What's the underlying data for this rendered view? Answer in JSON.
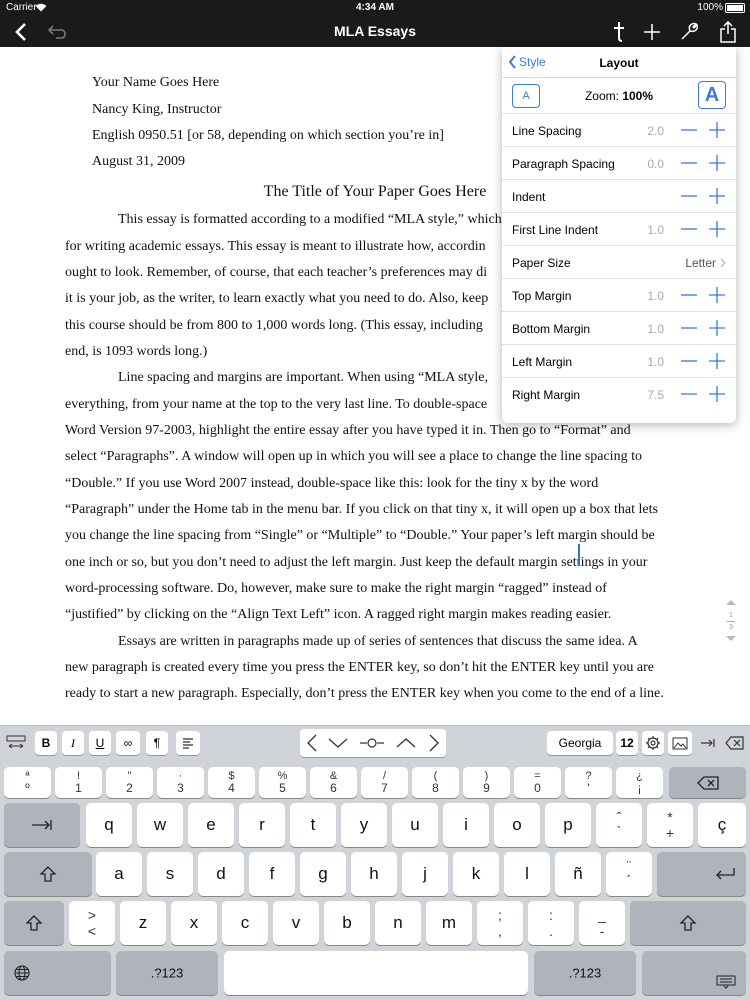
{
  "status_bar": {
    "carrier": "Carrier",
    "time": "4:34 AM",
    "battery": "100%"
  },
  "nav_bar": {
    "title": "MLA Essays",
    "icons": [
      "back-icon",
      "undo-icon",
      "text-style-icon",
      "add-icon",
      "wrench-icon",
      "share-icon"
    ]
  },
  "document": {
    "heading_lines": [
      "Your Name Goes Here",
      "Nancy King, Instructor",
      "English 0950.51 [or 58, depending on which section you’re in]",
      "August 31, 2009"
    ],
    "title": "The Title of Your Paper Goes Here",
    "body_lines": [
      "This essay is formatted according to a modified “MLA style,” which",
      "for writing academic essays.  This essay is meant to illustrate how, accordin",
      "ought to look.  Remember, of course, that each teacher’s preferences may di",
      "it is your job, as the writer, to learn exactly what you need to do.  Also, keep",
      "this course should be from 800 to 1,000 words long.  (This essay, including",
      "end, is 1093 words long.)",
      "Line spacing and margins are important.  When using “MLA style,",
      "everything, from your name at the top to the very last line.  To double-space",
      "Word Version 97-2003, highlight the entire essay after you have typed it in.  Then go to “Format” and",
      "select “Paragraphs”.  A window will open up in which you will see a place to change the line spacing to",
      "“Double.”   If you use Word 2007 instead, double-space like this:  look for the tiny x by the word",
      "“Paragraph” under the Home tab in the menu bar.  If you click on that tiny x, it will open up a box that lets",
      "you change the line spacing from “Single” or “Multiple” to “Double.”  Your paper’s left margin should be",
      "one inch or so, but you don’t need to adjust the left margin.  Just keep the default margin settings in your",
      "word-processing software.  Do, however, make sure to make the right margin “ragged” instead of",
      "“justified” by clicking on the “Align Text Left” icon.  A ragged right margin makes reading easier.",
      "Essays are written in paragraphs made up of series of sentences that discuss the same idea.  A",
      "new paragraph is created every time you press the ENTER key, so don’t hit the ENTER key until you are",
      "ready to start a new paragraph.  Especially, don’t press the ENTER key when you come to the end of a line."
    ],
    "pager": {
      "current": "1",
      "total": "3"
    }
  },
  "layout_panel": {
    "back_label": "Style",
    "title": "Layout",
    "zoom_label": "Zoom:",
    "zoom_value": "100%",
    "zoom_small_label": "A",
    "zoom_large_label": "A",
    "rows": [
      {
        "label": "Line Spacing",
        "value": "2.0"
      },
      {
        "label": "Paragraph Spacing",
        "value": "0.0"
      },
      {
        "label": "Indent",
        "value": ""
      },
      {
        "label": "First Line Indent",
        "value": "1.0"
      },
      {
        "label": "Paper Size",
        "value": "Letter"
      },
      {
        "label": "Top Margin",
        "value": "1.0"
      },
      {
        "label": "Bottom Margin",
        "value": "1.0"
      },
      {
        "label": "Left Margin",
        "value": "1.0"
      },
      {
        "label": "Right Margin",
        "value": "7.5"
      }
    ]
  },
  "format_toolbar": {
    "bold": "B",
    "italic": "I",
    "underline": "U",
    "link": "∞",
    "pilcrow": "¶",
    "font": "Georgia",
    "font_size": "12"
  },
  "keyboard": {
    "number_row": [
      {
        "top": "ª",
        "bot": "º"
      },
      {
        "top": "!",
        "bot": "1"
      },
      {
        "top": "\"",
        "bot": "2"
      },
      {
        "top": "·",
        "bot": "3"
      },
      {
        "top": "$",
        "bot": "4"
      },
      {
        "top": "%",
        "bot": "5"
      },
      {
        "top": "&",
        "bot": "6"
      },
      {
        "top": "/",
        "bot": "7"
      },
      {
        "top": "(",
        "bot": "8"
      },
      {
        "top": ")",
        "bot": "9"
      },
      {
        "top": "=",
        "bot": "0"
      },
      {
        "top": "?",
        "bot": "'"
      },
      {
        "top": "¿",
        "bot": "¡"
      }
    ],
    "row1": [
      "q",
      "w",
      "e",
      "r",
      "t",
      "y",
      "u",
      "i",
      "o",
      "p"
    ],
    "row1_extra": [
      {
        "top": "ˆ",
        "bot": "`"
      },
      {
        "top": "*",
        "bot": "+"
      }
    ],
    "row1_last": "ç",
    "row2": [
      "a",
      "s",
      "d",
      "f",
      "g",
      "h",
      "j",
      "k",
      "l",
      "ñ"
    ],
    "row2_extra": {
      "top": "¨",
      "bot": "´"
    },
    "row3_first": {
      "top": ">",
      "bot": "<"
    },
    "row3": [
      "z",
      "x",
      "c",
      "v",
      "b",
      "n",
      "m"
    ],
    "row3_extra": [
      {
        "top": ";",
        "bot": ","
      },
      {
        "top": ":",
        "bot": "."
      },
      {
        "top": "_",
        "bot": "-"
      }
    ],
    "mode_label": ".?123"
  },
  "colors": {
    "accent": "#3a7bd5",
    "bar": "#1a1a1a",
    "keyboard_bg": "#d0d3d8"
  }
}
